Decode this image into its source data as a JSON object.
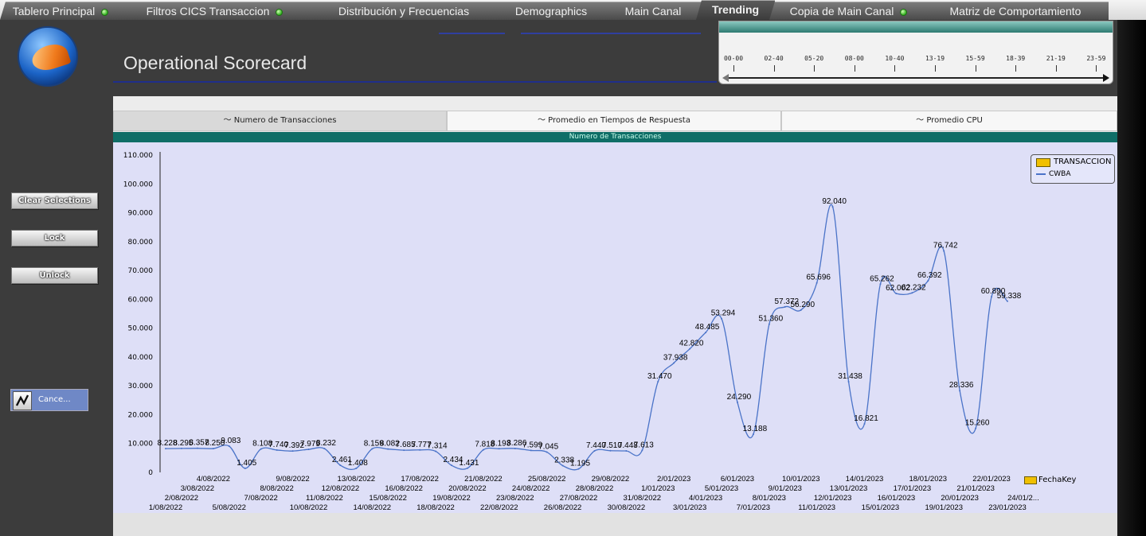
{
  "tabs": [
    {
      "label": "Tablero Principal",
      "dot": true
    },
    {
      "label": "Filtros CICS Transaccion",
      "dot": true
    },
    {
      "label": "Distribución y Frecuencias",
      "dot": false
    },
    {
      "label": "Demographics",
      "dot": false
    },
    {
      "label": "Main Canal",
      "dot": false
    },
    {
      "label": "Trending",
      "dot": false,
      "active": true
    },
    {
      "label": "Copia de Main Canal",
      "dot": true
    },
    {
      "label": "Matriz de Comportamiento",
      "dot": false
    }
  ],
  "header": {
    "title": "Operational Scorecard"
  },
  "time_slider": {
    "labels": [
      "00-00",
      "02-40",
      "05-20",
      "08-00",
      "10-40",
      "13-19",
      "15-59",
      "18-39",
      "21-19",
      "23-59"
    ]
  },
  "sidebar": {
    "clear_label": "Clear Selections",
    "lock_label": "Lock",
    "unlock_label": "Unlock",
    "cancel_label": "Cance..."
  },
  "panel_tabs": [
    "Numero de Transacciones",
    "Promedio en Tiempos de Respuesta",
    "Promedio CPU"
  ],
  "chart_caption": "Numero de Transacciones",
  "legend": {
    "title": "TRANSACCION",
    "series": "CWBA"
  },
  "x_field": "FechaKey",
  "colors": {
    "series": "#4a73c8",
    "caption_bar": "#0f6e67",
    "plot_bg": "#dedff7"
  },
  "chart_data": {
    "type": "line",
    "series": [
      {
        "name": "CWBA"
      }
    ],
    "ylim": [
      0,
      110000
    ],
    "y_ticks": [
      "0",
      "10.000",
      "20.000",
      "30.000",
      "40.000",
      "50.000",
      "60.000",
      "70.000",
      "80.000",
      "90.000",
      "100.000",
      "110.000"
    ],
    "points": [
      {
        "x": "1/08/2022",
        "y": 8228,
        "label": "8.228"
      },
      {
        "x": "2/08/2022",
        "y": 8295,
        "label": "8.295"
      },
      {
        "x": "3/08/2022",
        "y": 8357,
        "label": "8.357"
      },
      {
        "x": "4/08/2022",
        "y": 8250,
        "label": "8.250"
      },
      {
        "x": "5/08/2022",
        "y": 9083,
        "label": "9.083"
      },
      {
        "x": "6/08/2022",
        "y": 1405,
        "label": "1.405"
      },
      {
        "x": "7/08/2022",
        "y": 8108,
        "label": "8.108"
      },
      {
        "x": "8/08/2022",
        "y": 7740,
        "label": "7.740"
      },
      {
        "x": "9/08/2022",
        "y": 7392,
        "label": "7.392"
      },
      {
        "x": "10/08/2022",
        "y": 7979,
        "label": "7.979"
      },
      {
        "x": "11/08/2022",
        "y": 8232,
        "label": "8.232"
      },
      {
        "x": "12/08/2022",
        "y": 2461,
        "label": "2.461"
      },
      {
        "x": "13/08/2022",
        "y": 1408,
        "label": "1.408"
      },
      {
        "x": "14/08/2022",
        "y": 8159,
        "label": "8.159"
      },
      {
        "x": "15/08/2022",
        "y": 8082,
        "label": "8.082"
      },
      {
        "x": "16/08/2022",
        "y": 7685,
        "label": "7.685"
      },
      {
        "x": "17/08/2022",
        "y": 7777,
        "label": "7.777"
      },
      {
        "x": "18/08/2022",
        "y": 7314,
        "label": "7.314"
      },
      {
        "x": "19/08/2022",
        "y": 2434,
        "label": "2.434"
      },
      {
        "x": "20/08/2022",
        "y": 1431,
        "label": "1.431"
      },
      {
        "x": "21/08/2022",
        "y": 7818,
        "label": "7.818"
      },
      {
        "x": "22/08/2022",
        "y": 8193,
        "label": "8.193"
      },
      {
        "x": "23/08/2022",
        "y": 8286,
        "label": "8.286"
      },
      {
        "x": "24/08/2022",
        "y": 7599,
        "label": "7.599"
      },
      {
        "x": "25/08/2022",
        "y": 7045,
        "label": "7.045"
      },
      {
        "x": "26/08/2022",
        "y": 2338,
        "label": "2.338"
      },
      {
        "x": "27/08/2022",
        "y": 1195,
        "label": "1.195"
      },
      {
        "x": "28/08/2022",
        "y": 7440,
        "label": "7.440"
      },
      {
        "x": "29/08/2022",
        "y": 7510,
        "label": "7.510"
      },
      {
        "x": "30/08/2022",
        "y": 7448,
        "label": "7.448"
      },
      {
        "x": "31/08/2022",
        "y": 7613,
        "label": "7.613"
      },
      {
        "x": "1/01/2023",
        "y": 31470,
        "label": "31.470"
      },
      {
        "x": "2/01/2023",
        "y": 37938,
        "label": "37.938"
      },
      {
        "x": "3/01/2023",
        "y": 42820,
        "label": "42.820"
      },
      {
        "x": "4/01/2023",
        "y": 48485,
        "label": "48.485"
      },
      {
        "x": "5/01/2023",
        "y": 53294,
        "label": "53.294"
      },
      {
        "x": "6/01/2023",
        "y": 24290,
        "label": "24.290"
      },
      {
        "x": "7/01/2023",
        "y": 13188,
        "label": "13.188"
      },
      {
        "x": "8/01/2023",
        "y": 51360,
        "label": "51.360"
      },
      {
        "x": "9/01/2023",
        "y": 57372,
        "label": "57.372"
      },
      {
        "x": "10/01/2023",
        "y": 56290,
        "label": "56.290"
      },
      {
        "x": "11/01/2023",
        "y": 65696,
        "label": "65.696"
      },
      {
        "x": "12/01/2023",
        "y": 92040,
        "label": "92.040"
      },
      {
        "x": "13/01/2023",
        "y": 31438,
        "label": "31.438"
      },
      {
        "x": "14/01/2023",
        "y": 16821,
        "label": "16.821"
      },
      {
        "x": "15/01/2023",
        "y": 65262,
        "label": "65.262"
      },
      {
        "x": "16/01/2023",
        "y": 62002,
        "label": "62.002"
      },
      {
        "x": "17/01/2023",
        "y": 62232,
        "label": "62.232"
      },
      {
        "x": "18/01/2023",
        "y": 66392,
        "label": "66.392"
      },
      {
        "x": "19/01/2023",
        "y": 76742,
        "label": "76.742"
      },
      {
        "x": "20/01/2023",
        "y": 28336,
        "label": "28.336"
      },
      {
        "x": "21/01/2023",
        "y": 15260,
        "label": "15.260"
      },
      {
        "x": "22/01/2023",
        "y": 60890,
        "label": "60.890"
      },
      {
        "x": "23/01/2023",
        "y": 59338,
        "label": "59.338"
      }
    ],
    "x_tick_rows": [
      [
        "4/08/2022",
        "9/08/2022",
        "13/08/2022",
        "17/08/2022",
        "21/08/2022",
        "25/08/2022",
        "29/08/2022",
        "2/01/2023",
        "6/01/2023",
        "10/01/2023",
        "14/01/2023",
        "18/01/2023",
        "22/01/2023"
      ],
      [
        "3/08/2022",
        "8/08/2022",
        "12/08/2022",
        "16/08/2022",
        "20/08/2022",
        "24/08/2022",
        "28/08/2022",
        "1/01/2023",
        "5/01/2023",
        "9/01/2023",
        "13/01/2023",
        "17/01/2023",
        "21/01/2023"
      ],
      [
        "2/08/2022",
        "7/08/2022",
        "11/08/2022",
        "15/08/2022",
        "19/08/2022",
        "23/08/2022",
        "27/08/2022",
        "31/08/2022",
        "4/01/2023",
        "8/01/2023",
        "12/01/2023",
        "16/01/2023",
        "20/01/2023",
        "24/01/2..."
      ],
      [
        "1/08/2022",
        "5/08/2022",
        "10/08/2022",
        "14/08/2022",
        "18/08/2022",
        "22/08/2022",
        "26/08/2022",
        "30/08/2022",
        "3/01/2023",
        "7/01/2023",
        "11/01/2023",
        "15/01/2023",
        "19/01/2023",
        "23/01/2023"
      ]
    ]
  }
}
